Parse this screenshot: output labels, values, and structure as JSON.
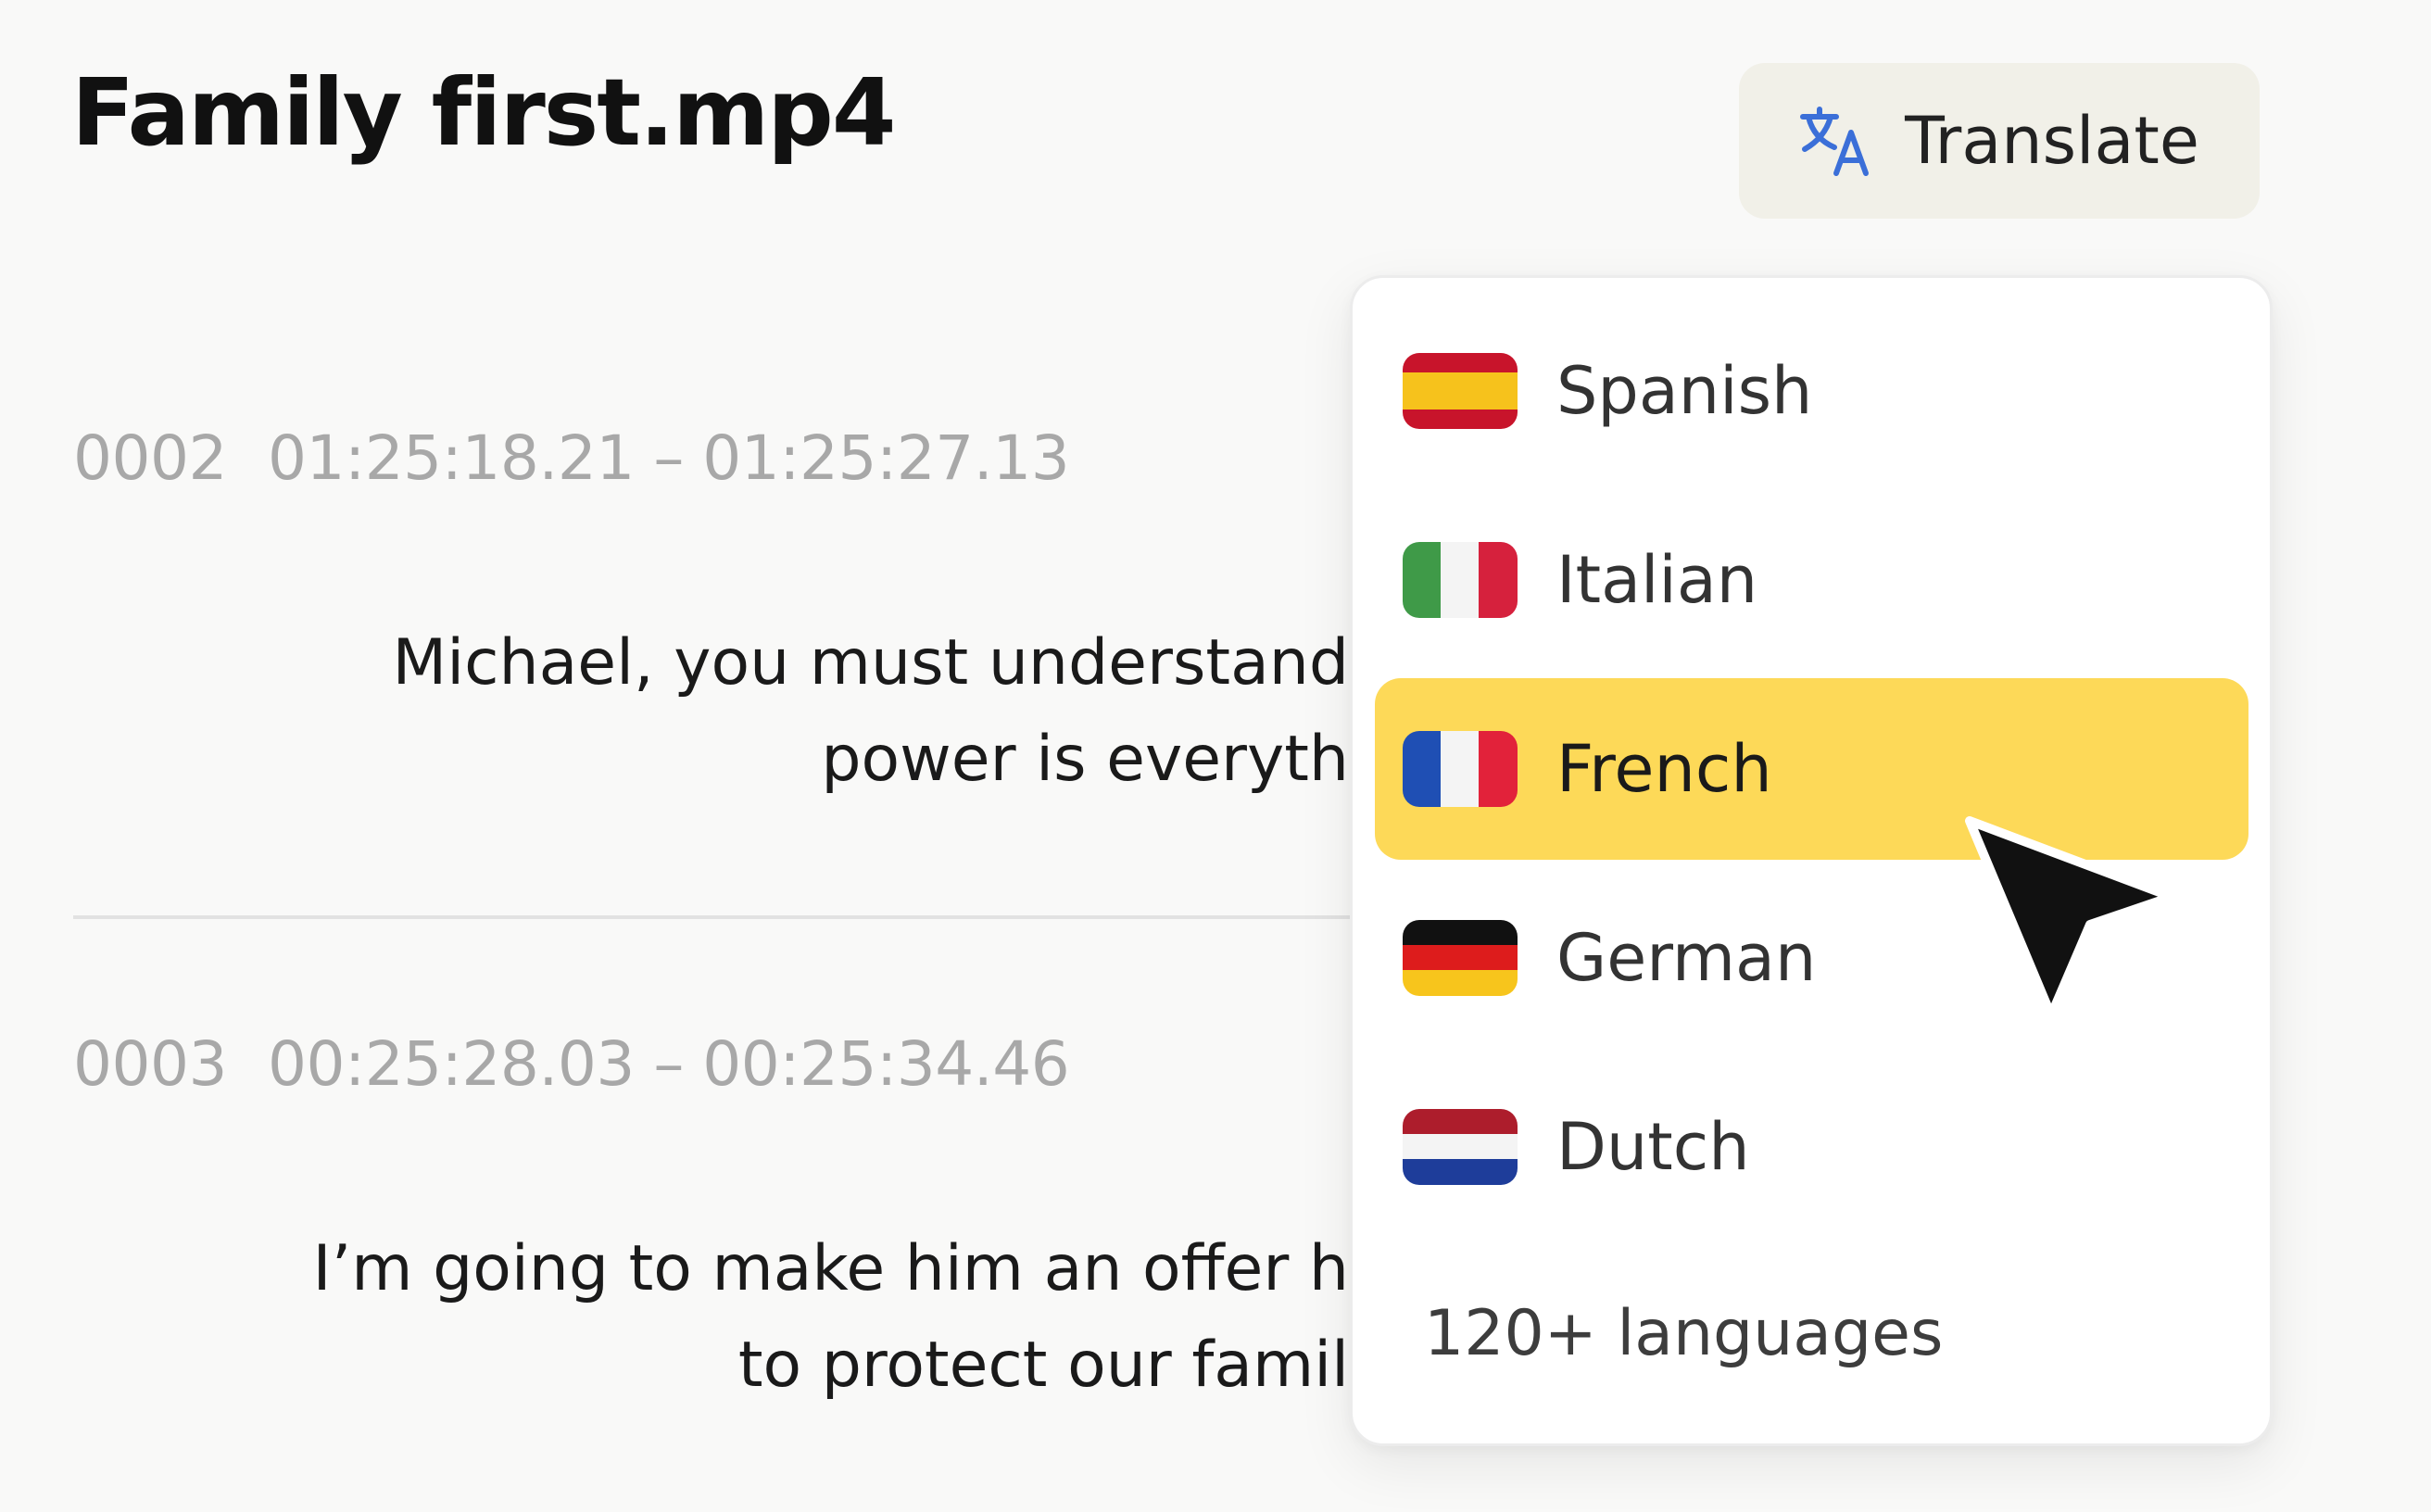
{
  "header": {
    "title": "Family first.mp4",
    "translate_button": {
      "label": "Translate",
      "icon": "translate-icon"
    }
  },
  "segments": [
    {
      "index": "0002",
      "timecode": "01:25:18.21 – 01:25:27.13",
      "lines": [
        "Michael, you must understand",
        "power is everyth"
      ]
    },
    {
      "index": "0003",
      "timecode": "00:25:28.03 – 00:25:34.46",
      "lines": [
        "I’m going to make him an offer h",
        "to protect our famil"
      ]
    }
  ],
  "language_menu": {
    "items": [
      {
        "label": "Spanish",
        "flag": "spain-flag-icon",
        "selected": false
      },
      {
        "label": "Italian",
        "flag": "italy-flag-icon",
        "selected": false
      },
      {
        "label": "French",
        "flag": "france-flag-icon",
        "selected": true
      },
      {
        "label": "German",
        "flag": "germany-flag-icon",
        "selected": false
      },
      {
        "label": "Dutch",
        "flag": "netherlands-flag-icon",
        "selected": false
      }
    ],
    "more_label": "120+ languages",
    "highlight_color": "#fdd958"
  },
  "colors": {
    "background": "#f9f9f8",
    "button_background": "#f1f0e8",
    "translate_icon": "#3b6fd8",
    "timecode": "#a8a8a8",
    "cursor": "#111111"
  }
}
